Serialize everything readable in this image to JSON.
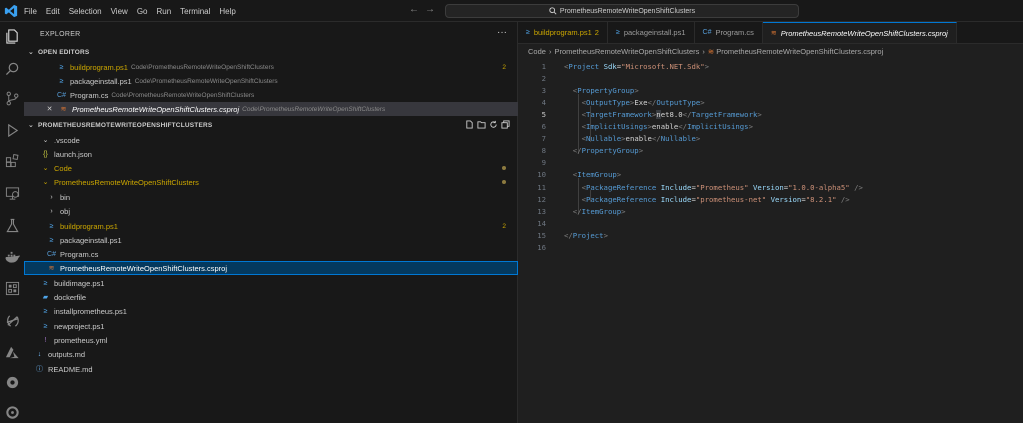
{
  "menu": [
    "File",
    "Edit",
    "Selection",
    "View",
    "Go",
    "Run",
    "Terminal",
    "Help"
  ],
  "search": {
    "text": "PrometheusRemoteWriteOpenShiftClusters"
  },
  "activity_icons": [
    "explorer-icon",
    "search-icon",
    "source-control-icon",
    "run-debug-icon",
    "extensions-icon",
    "remote-explorer-icon",
    "testing-icon",
    "docker-icon",
    "kubernetes-icon",
    "openshift-icon",
    "azure-icon",
    "gear-icon",
    "cluster-icon"
  ],
  "sidebar": {
    "title": "EXPLORER",
    "open_editors": {
      "label": "OPEN EDITORS",
      "items": [
        {
          "name": "buildprogram.ps1",
          "path": "Code\\PrometheusRemoteWriteOpenShiftClusters",
          "badge": "2"
        },
        {
          "name": "packageinstall.ps1",
          "path": "Code\\PrometheusRemoteWriteOpenShiftClusters",
          "badge": ""
        },
        {
          "name": "Program.cs",
          "path": "Code\\PrometheusRemoteWriteOpenShiftClusters",
          "badge": ""
        },
        {
          "name": "PrometheusRemoteWriteOpenShiftClusters.csproj",
          "path": "Code\\PrometheusRemoteWriteOpenShiftClusters",
          "badge": ""
        }
      ]
    },
    "folder": {
      "label": "PROMETHEUSREMOTEWRITEOPENSHIFTCLUSTERS",
      "items": [
        {
          "name": ".vscode"
        },
        {
          "name": "launch.json"
        },
        {
          "name": "Code"
        },
        {
          "name": "PrometheusRemoteWriteOpenShiftClusters"
        },
        {
          "name": "bin"
        },
        {
          "name": "obj"
        },
        {
          "name": "buildprogram.ps1",
          "badge": "2"
        },
        {
          "name": "packageinstall.ps1"
        },
        {
          "name": "Program.cs"
        },
        {
          "name": "PrometheusRemoteWriteOpenShiftClusters.csproj"
        },
        {
          "name": "buildimage.ps1"
        },
        {
          "name": "dockerfile"
        },
        {
          "name": "installprometheus.ps1"
        },
        {
          "name": "newproject.ps1"
        },
        {
          "name": "prometheus.yml"
        },
        {
          "name": "outputs.md"
        },
        {
          "name": "README.md"
        }
      ]
    }
  },
  "tabs": [
    {
      "label": "buildprogram.ps1",
      "badge": "2"
    },
    {
      "label": "packageinstall.ps1",
      "badge": ""
    },
    {
      "label": "Program.cs",
      "badge": ""
    },
    {
      "label": "PrometheusRemoteWriteOpenShiftClusters.csproj",
      "badge": ""
    }
  ],
  "breadcrumbs": [
    "Code",
    "PrometheusRemoteWriteOpenShiftClusters",
    "PrometheusRemoteWriteOpenShiftClusters.csproj"
  ],
  "editor": {
    "current_line": 5,
    "lines": [
      "<Project Sdk=\"Microsoft.NET.Sdk\">",
      "",
      "  <PropertyGroup>",
      "    <OutputType>Exe</OutputType>",
      "    <TargetFramework>net8.0</TargetFramework>",
      "    <ImplicitUsings>enable</ImplicitUsings>",
      "    <Nullable>enable</Nullable>",
      "  </PropertyGroup>",
      "",
      "  <ItemGroup>",
      "    <PackageReference Include=\"Prometheus\" Version=\"1.0.0-alpha5\" />",
      "    <PackageReference Include=\"prometheus-net\" Version=\"8.2.1\" />",
      "  </ItemGroup>",
      "",
      "</Project>",
      ""
    ]
  },
  "colors": {
    "accent": "#0078d4",
    "modified": "#cca700",
    "tag_name": "#569cd6",
    "attribute": "#9cdcfe",
    "string": "#ce9178"
  }
}
